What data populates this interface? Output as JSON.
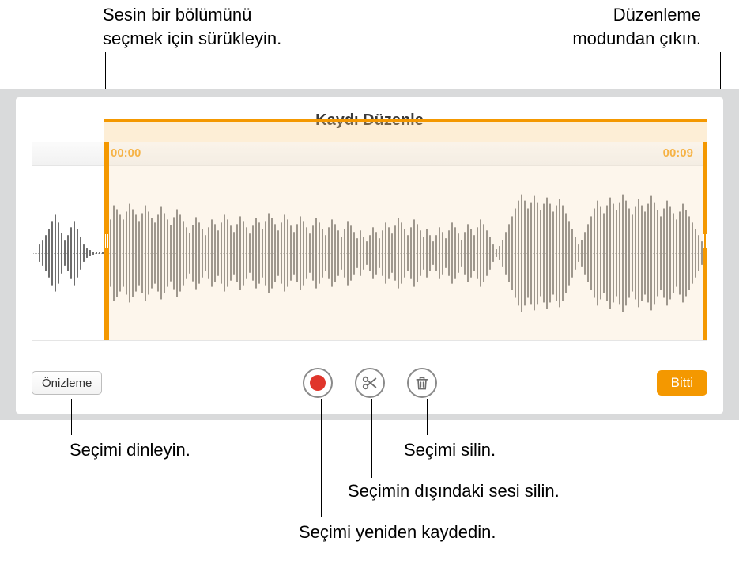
{
  "callouts": {
    "drag_select": "Sesin bir bölümünü\nseçmek için sürükleyin.",
    "exit_edit": "Düzenleme\nmodundan çıkın.",
    "listen_selection": "Seçimi dinleyin.",
    "delete_selection": "Seçimi silin.",
    "delete_outside": "Seçimin dışındaki sesi silin.",
    "rerecord_selection": "Seçimi yeniden kaydedin."
  },
  "editor": {
    "title": "Kaydı Düzenle",
    "time_start": "00:00",
    "time_end": "00:09",
    "preview_label": "Önizleme",
    "done_label": "Bitti"
  },
  "icons": {
    "record": "record-icon",
    "trim": "scissors-icon",
    "delete": "trash-icon"
  },
  "colors": {
    "accent": "#f49800",
    "record_red": "#e0352b",
    "wave": "#6e6e6e"
  }
}
